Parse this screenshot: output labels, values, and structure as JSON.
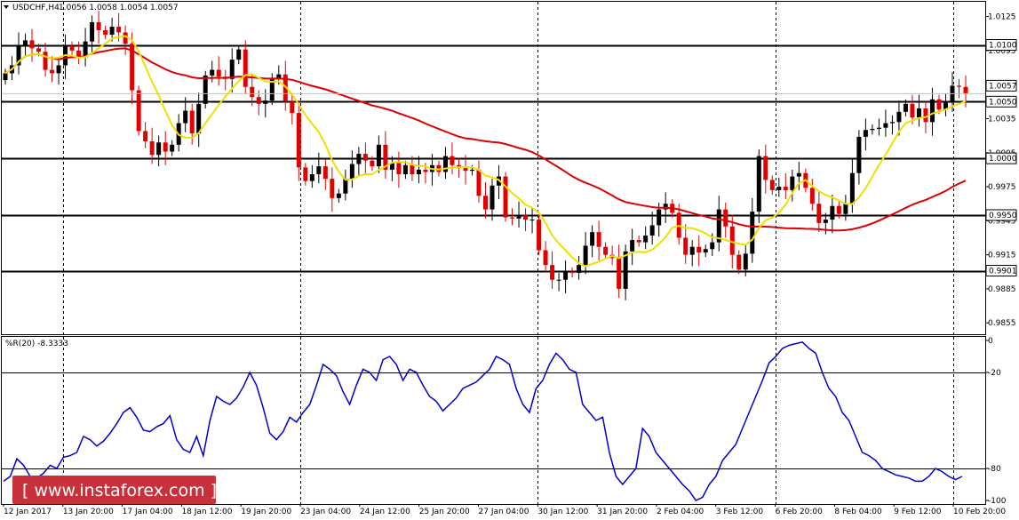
{
  "header": {
    "symbol_label": "USDCHF,H4",
    "ohlc_label": "1.0056 1.0058 1.0054 1.0057"
  },
  "indicator_header": "%R(20) -8.3333",
  "watermark": "[ www.instaforex.com ]",
  "colors": {
    "bull": "#000000",
    "bear": "#e00000",
    "ma_fast": "#f0e000",
    "ma_slow": "#dd0000",
    "wpr": "#0000cc",
    "levels": "#000000",
    "watermark_bg": "#c8303a"
  },
  "chart_data": [
    {
      "type": "candlestick",
      "symbol": "USDCHF",
      "timeframe": "H4",
      "ylim": [
        0.9845,
        1.0138
      ],
      "y_ticks": [
        "1.0125",
        "1.0095",
        "1.0065",
        "1.0035",
        "1.0005",
        "0.9975",
        "0.9945",
        "0.9915",
        "0.9885",
        "0.9855"
      ],
      "x_ticks": [
        "12 Jan 2017",
        "13 Jan 20:00",
        "17 Jan 04:00",
        "18 Jan 12:00",
        "19 Jan 20:00",
        "23 Jan 04:00",
        "24 Jan 12:00",
        "25 Jan 20:00",
        "27 Jan 04:00",
        "30 Jan 12:00",
        "31 Jan 20:00",
        "2 Feb 04:00",
        "3 Feb 12:00",
        "6 Feb 20:00",
        "8 Feb 04:00",
        "9 Feb 12:00",
        "10 Feb 20:00"
      ],
      "levels": [
        {
          "value": 1.01,
          "label": "1.0100"
        },
        {
          "value": 1.005,
          "label": "1.0050"
        },
        {
          "value": 1.0,
          "label": "1.0000"
        },
        {
          "value": 0.995,
          "label": "0.9950"
        },
        {
          "value": 0.9901,
          "label": "0.9901"
        }
      ],
      "current_price": {
        "value": 1.0057,
        "label": "1.0057"
      },
      "series_close": [
        1.0075,
        1.0082,
        1.0099,
        1.0104,
        1.0097,
        1.0094,
        1.0078,
        1.0075,
        1.0082,
        1.0099,
        1.0095,
        1.0089,
        1.0103,
        1.012,
        1.0113,
        1.0109,
        1.0116,
        1.0111,
        1.0101,
        1.006,
        1.0024,
        1.0015,
        1.0003,
        1.0014,
        1.0006,
        1.0012,
        1.0031,
        1.0042,
        1.0022,
        1.0048,
        1.0073,
        1.0078,
        1.0072,
        1.007,
        1.0087,
        1.0096,
        1.0063,
        1.0054,
        1.0048,
        1.0051,
        1.0071,
        1.0074,
        1.005,
        1.004,
        0.9992,
        0.998,
        0.9986,
        0.9993,
        0.9982,
        0.9965,
        0.9969,
        0.9982,
        0.9995,
        1.0004,
        0.9998,
        0.9993,
        1.0012,
        0.999,
        0.9996,
        0.9986,
        0.9994,
        0.9986,
        0.999,
        0.9988,
        0.9994,
        0.9988,
        1.0002,
        0.9994,
        0.9993,
        0.9989,
        0.999,
        0.9967,
        0.9955,
        0.9976,
        0.9984,
        0.9948,
        0.9947,
        0.995,
        0.9946,
        0.9946,
        0.9919,
        0.9906,
        0.9893,
        0.9893,
        0.99,
        0.9899,
        0.9906,
        0.9923,
        0.9935,
        0.9922,
        0.9915,
        0.9912,
        0.9885,
        0.9918,
        0.9928,
        0.9926,
        0.9932,
        0.9941,
        0.9955,
        0.996,
        0.9952,
        0.993,
        0.9915,
        0.9922,
        0.9917,
        0.992,
        0.9926,
        0.9955,
        0.994,
        0.9915,
        0.9902,
        0.9916,
        0.9953,
        1.0002,
        0.9981,
        0.9972,
        0.9975,
        0.9972,
        0.9984,
        0.9987,
        0.9974,
        0.996,
        0.9943,
        0.9946,
        0.9958,
        0.9951,
        0.996,
        0.9987,
        1.0019,
        1.0025,
        1.0026,
        1.0027,
        1.0031,
        1.0032,
        1.0041,
        1.0048,
        1.0036,
        1.0044,
        1.0032,
        1.0052,
        1.0043,
        1.0049,
        1.0064,
        1.0063,
        1.0057
      ],
      "series_ma_fast_name": "",
      "series_ma_slow_name": ""
    },
    {
      "type": "line",
      "indicator": "%R(20)",
      "ylim": [
        -100,
        0
      ],
      "y_ticks": [
        "0",
        "-20",
        "-80",
        "-100"
      ],
      "levels": [
        -20,
        -80
      ],
      "values": [
        -88,
        -85,
        -74,
        -78,
        -85,
        -86,
        -83,
        -78,
        -80,
        -73,
        -72,
        -70,
        -60,
        -62,
        -66,
        -63,
        -58,
        -52,
        -45,
        -42,
        -48,
        -56,
        -57,
        -54,
        -52,
        -47,
        -62,
        -68,
        -70,
        -60,
        -72,
        -50,
        -35,
        -38,
        -40,
        -36,
        -29,
        -20,
        -28,
        -42,
        -58,
        -62,
        -57,
        -48,
        -51,
        -45,
        -40,
        -28,
        -15,
        -18,
        -22,
        -32,
        -40,
        -28,
        -18,
        -20,
        -25,
        -12,
        -10,
        -15,
        -25,
        -18,
        -20,
        -28,
        -35,
        -38,
        -44,
        -40,
        -36,
        -30,
        -28,
        -26,
        -22,
        -18,
        -10,
        -12,
        -15,
        -30,
        -40,
        -45,
        -30,
        -25,
        -15,
        -8,
        -12,
        -18,
        -20,
        -40,
        -45,
        -50,
        -48,
        -70,
        -85,
        -90,
        -85,
        -80,
        -55,
        -60,
        -70,
        -75,
        -80,
        -85,
        -90,
        -94,
        -100,
        -98,
        -90,
        -85,
        -75,
        -70,
        -65,
        -55,
        -45,
        -35,
        -25,
        -14,
        -10,
        -5,
        -3,
        -2,
        -1,
        -5,
        -8,
        -20,
        -30,
        -35,
        -45,
        -50,
        -60,
        -70,
        -72,
        -75,
        -80,
        -82,
        -84,
        -85,
        -86,
        -88,
        -88,
        -85,
        -80,
        -82,
        -85,
        -87,
        -85
      ]
    }
  ]
}
